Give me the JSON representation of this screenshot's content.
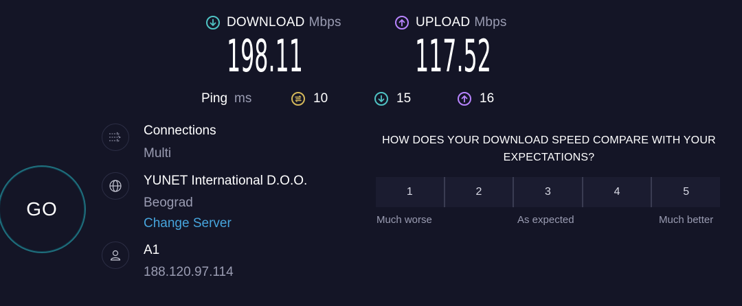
{
  "download": {
    "label": "DOWNLOAD",
    "unit": "Mbps",
    "value": "198.11",
    "icon": "arrow-down-circle-icon",
    "color": "#4fc3c4"
  },
  "upload": {
    "label": "UPLOAD",
    "unit": "Mbps",
    "value": "117.52",
    "icon": "arrow-up-circle-icon",
    "color": "#b884ff"
  },
  "ping": {
    "label": "Ping",
    "unit": "ms",
    "idle": {
      "value": "10",
      "icon": "ping-idle-icon",
      "color": "#d4b85a"
    },
    "download": {
      "value": "15",
      "icon": "ping-download-icon",
      "color": "#4fc3c4"
    },
    "upload": {
      "value": "16",
      "icon": "ping-upload-icon",
      "color": "#b884ff"
    }
  },
  "go_button": {
    "label": "GO"
  },
  "connections": {
    "title": "Connections",
    "value": "Multi",
    "icon": "connections-icon"
  },
  "server": {
    "name": "YUNET International D.O.O.",
    "location": "Beograd",
    "change_label": "Change Server",
    "icon": "globe-icon"
  },
  "provider": {
    "name": "A1",
    "ip": "188.120.97.114",
    "icon": "user-icon"
  },
  "survey": {
    "question": "HOW DOES YOUR DOWNLOAD SPEED COMPARE WITH YOUR EXPECTATIONS?",
    "options": [
      "1",
      "2",
      "3",
      "4",
      "5"
    ],
    "caption_low": "Much worse",
    "caption_mid": "As expected",
    "caption_high": "Much better"
  },
  "colors": {
    "background": "#141526",
    "accent_link": "#46a4dc",
    "muted": "#9a9cb2"
  }
}
